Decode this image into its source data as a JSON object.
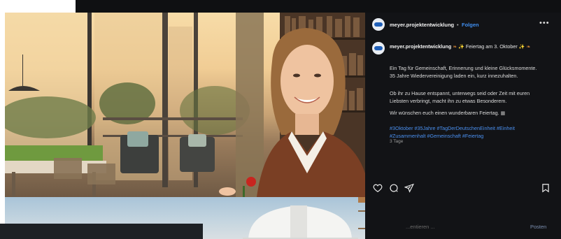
{
  "header": {
    "username": "meyer.projektentwicklung",
    "separator": "•",
    "follow_label": "Folgen",
    "more_icon": "more-horizontal-icon"
  },
  "post": {
    "username": "meyer.projektentwicklung",
    "title_text": "Feiertag am 3. Oktober",
    "paragraph_1": "Ein Tag für Gemeinschaft, Erinnerung und kleine Glücksmomente. 35 Jahre Wiedervereinigung laden ein, kurz innezuhalten.",
    "paragraph_2": "Ob ihr zu Hause entspannt, unterwegs seid oder Zeit mit euren Liebsten verbringt, macht ihn zu etwas Besonderem.",
    "paragraph_3": "Wir wünschen euch einen wunderbaren Feiertag.",
    "hashtags": "#3Oktober #35Jahre #TagDerDeutschenEinheit #Einheit #Zusammenhalt #Gemeinschaft #Feiertag",
    "timestamp": "3 Tage"
  },
  "actions": {
    "like_icon": "heart-icon",
    "comment_icon": "comment-icon",
    "share_icon": "share-icon",
    "save_icon": "bookmark-icon"
  },
  "comment_box": {
    "placeholder": "...entieren ...",
    "post_label": "Posten"
  },
  "colors": {
    "panel_bg": "#121316",
    "link_blue": "#3f8ef0",
    "hashtag_blue": "#4a90f0"
  }
}
